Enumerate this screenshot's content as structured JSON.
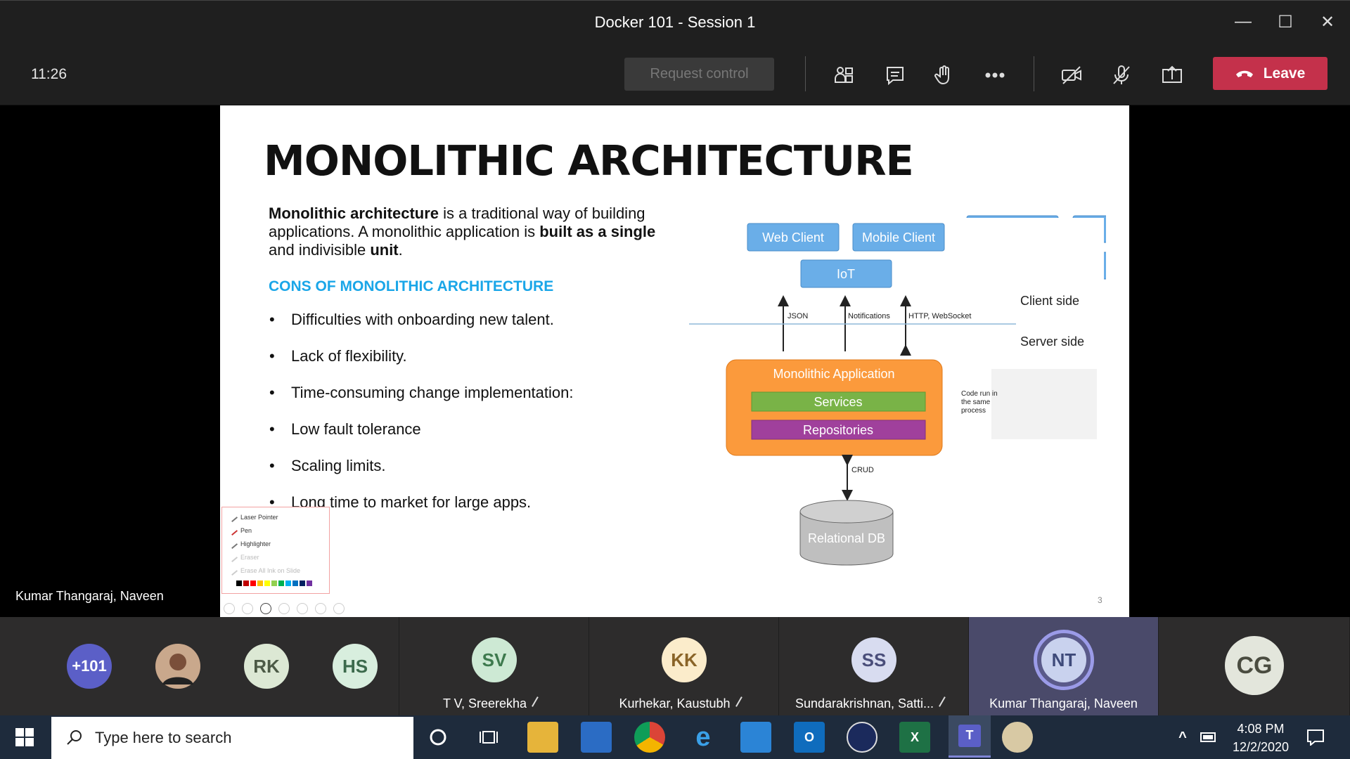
{
  "window": {
    "title": "Docker 101 - Session 1"
  },
  "meeting": {
    "clock": "11:26",
    "request_control": "Request control",
    "leave": "Leave"
  },
  "slide": {
    "heading": "MONOLITHIC ARCHITECTURE",
    "intro_bold1": "Monolithic architecture",
    "intro_text1": " is a traditional way of building applications. A monolithic application is ",
    "intro_bold2": "built as a single",
    "intro_text2": " and indivisible ",
    "intro_bold3": "unit",
    "intro_text3": ".",
    "cons_heading": "CONS OF MONOLITHIC ARCHITECTURE",
    "bullets": [
      "Difficulties with onboarding new talent.",
      "Lack of flexibility.",
      "Time-consuming change implementation:",
      "Low fault tolerance",
      "Scaling limits.",
      "Long time to market for large apps."
    ],
    "number": "3",
    "diagram": {
      "web_client": "Web Client",
      "mobile_client": "Mobile Client",
      "iot": "IoT",
      "json": "JSON",
      "notifications": "Notifications",
      "http": "HTTP, WebSocket",
      "client_side": "Client side",
      "server_side": "Server side",
      "mono_app": "Monolithic Application",
      "services": "Services",
      "repositories": "Repositories",
      "code_run_1": "Code run in",
      "code_run_2": "the same",
      "code_run_3": "process",
      "crud": "CRUD",
      "db": "Relational DB"
    }
  },
  "pen_menu": {
    "items": [
      "Laser Pointer",
      "Pen",
      "Highlighter",
      "Eraser",
      "Erase All Ink on Slide"
    ],
    "colors": [
      "#000000",
      "#c00000",
      "#ff0000",
      "#ffc000",
      "#ffff00",
      "#92d050",
      "#00b050",
      "#00b0f0",
      "#0070c0",
      "#002060",
      "#7030a0"
    ]
  },
  "speaker_label": "Kumar Thangaraj, Naveen",
  "gallery": {
    "overflow": "+101",
    "participants": [
      {
        "initials": "RK",
        "name": ""
      },
      {
        "initials": "HS",
        "name": ""
      },
      {
        "initials": "SV",
        "name": "T V, Sreerekha"
      },
      {
        "initials": "KK",
        "name": "Kurhekar, Kaustubh"
      },
      {
        "initials": "SS",
        "name": "Sundarakrishnan, Satti..."
      },
      {
        "initials": "NT",
        "name": "Kumar Thangaraj, Naveen"
      },
      {
        "initials": "CG",
        "name": ""
      }
    ]
  },
  "taskbar": {
    "search_placeholder": "Type here to search",
    "time": "4:08 PM",
    "date": "12/2/2020"
  }
}
